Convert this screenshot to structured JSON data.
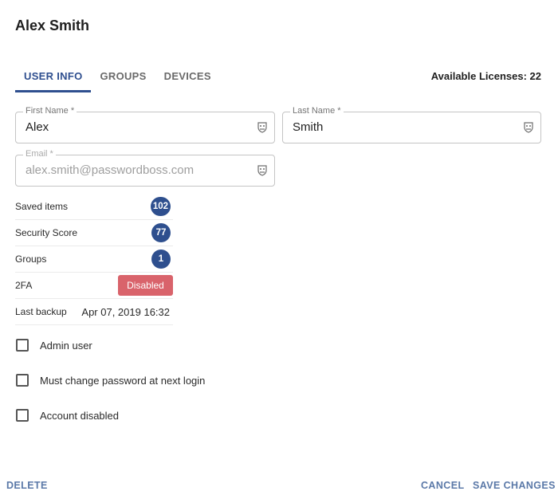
{
  "header": {
    "title": "Alex Smith"
  },
  "tabs": [
    {
      "label": "USER INFO"
    },
    {
      "label": "GROUPS"
    },
    {
      "label": "DEVICES"
    }
  ],
  "licenses": "Available Licenses: 22",
  "fields": {
    "first_name": {
      "label": "First Name *",
      "value": "Alex"
    },
    "last_name": {
      "label": "Last Name *",
      "value": "Smith"
    },
    "email": {
      "label": "Email *",
      "value": "alex.smith@passwordboss.com"
    }
  },
  "stats": {
    "saved_items": {
      "label": "Saved items",
      "value": "102"
    },
    "security_score": {
      "label": "Security Score",
      "value": "77"
    },
    "groups": {
      "label": "Groups",
      "value": "1"
    },
    "twofa": {
      "label": "2FA",
      "value": "Disabled"
    },
    "last_backup": {
      "label": "Last backup",
      "value": "Apr 07, 2019 16:32"
    }
  },
  "checkboxes": [
    {
      "label": "Admin user",
      "checked": false
    },
    {
      "label": "Must change password at next login",
      "checked": false
    },
    {
      "label": "Account disabled",
      "checked": false
    }
  ],
  "actions": {
    "delete": "DELETE",
    "cancel": "CANCEL",
    "save": "SAVE CHANGES"
  },
  "colors": {
    "accent": "#2f4f8f",
    "badge": "#2e4f8e",
    "danger": "#d9636b",
    "action": "#5b79a8"
  },
  "icons": {
    "field_icon": "password-manager-icon"
  }
}
